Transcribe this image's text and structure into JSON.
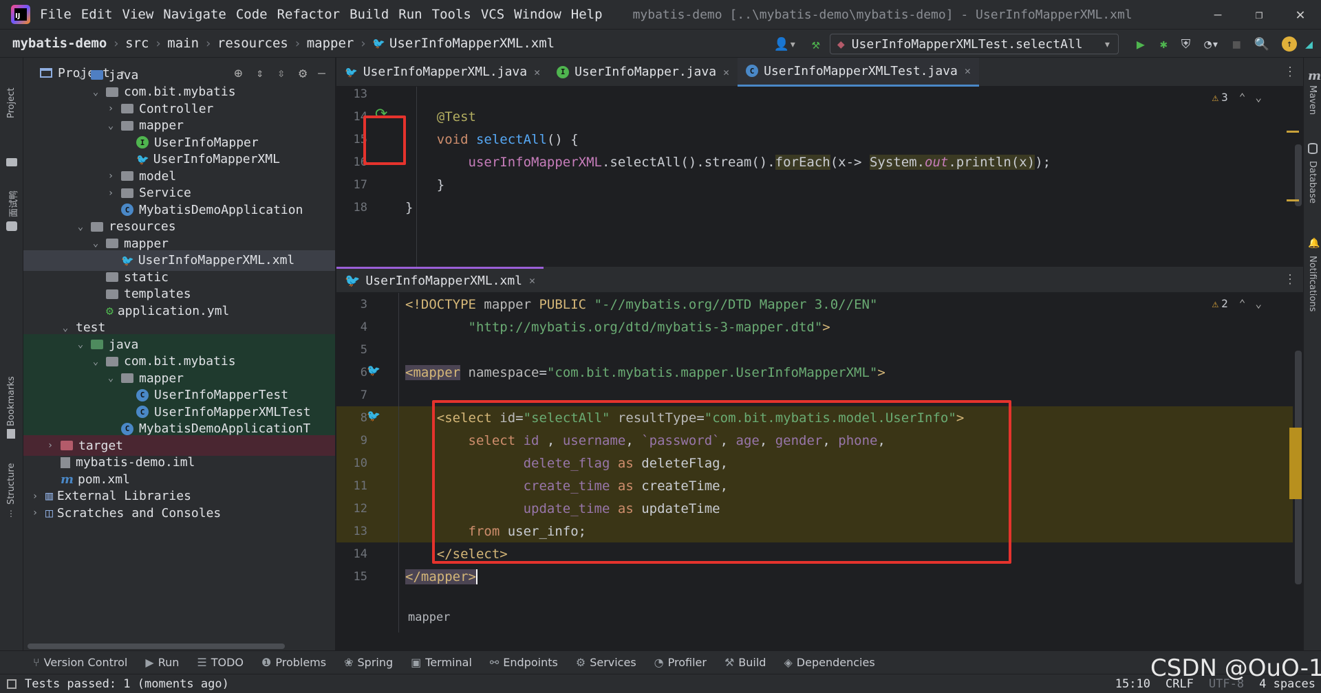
{
  "menu": [
    "File",
    "Edit",
    "View",
    "Navigate",
    "Code",
    "Refactor",
    "Build",
    "Run",
    "Tools",
    "VCS",
    "Window",
    "Help"
  ],
  "window_title": "mybatis-demo [..\\mybatis-demo\\mybatis-demo] - UserInfoMapperXML.xml",
  "breadcrumbs": [
    "mybatis-demo",
    "src",
    "main",
    "resources",
    "mapper",
    "UserInfoMapperXML.xml"
  ],
  "run_config": "UserInfoMapperXMLTest.selectAll",
  "left_stripe": {
    "project": "Project",
    "other": "面试鸭",
    "bookmarks": "Bookmarks",
    "structure": "Structure"
  },
  "right_stripe": {
    "maven": "Maven",
    "database": "Database",
    "notifications": "Notifications"
  },
  "project_panel": {
    "title": "Project",
    "tree": [
      {
        "label": "java",
        "depth": 3,
        "arrow": "open",
        "icon": "fold blue",
        "style": ""
      },
      {
        "label": "com.bit.mybatis",
        "depth": 4,
        "arrow": "open",
        "icon": "fold",
        "style": ""
      },
      {
        "label": "Controller",
        "depth": 5,
        "arrow": "closed",
        "icon": "fold",
        "style": ""
      },
      {
        "label": "mapper",
        "depth": 5,
        "arrow": "open",
        "icon": "fold",
        "style": ""
      },
      {
        "label": "UserInfoMapper",
        "depth": 6,
        "arrow": "",
        "icon": "interface",
        "style": ""
      },
      {
        "label": "UserInfoMapperXML",
        "depth": 6,
        "arrow": "",
        "icon": "bird",
        "style": ""
      },
      {
        "label": "model",
        "depth": 5,
        "arrow": "closed",
        "icon": "fold",
        "style": ""
      },
      {
        "label": "Service",
        "depth": 5,
        "arrow": "closed",
        "icon": "fold",
        "style": ""
      },
      {
        "label": "MybatisDemoApplication",
        "depth": 5,
        "arrow": "",
        "icon": "spring",
        "style": ""
      },
      {
        "label": "resources",
        "depth": 3,
        "arrow": "open",
        "icon": "fold",
        "style": ""
      },
      {
        "label": "mapper",
        "depth": 4,
        "arrow": "open",
        "icon": "fold",
        "style": ""
      },
      {
        "label": "UserInfoMapperXML.xml",
        "depth": 5,
        "arrow": "",
        "icon": "bird",
        "style": "sel"
      },
      {
        "label": "static",
        "depth": 4,
        "arrow": "",
        "icon": "fold",
        "style": ""
      },
      {
        "label": "templates",
        "depth": 4,
        "arrow": "",
        "icon": "fold",
        "style": ""
      },
      {
        "label": "application.yml",
        "depth": 4,
        "arrow": "",
        "icon": "yml",
        "style": ""
      },
      {
        "label": "test",
        "depth": 2,
        "arrow": "open",
        "icon": "",
        "style": ""
      },
      {
        "label": "java",
        "depth": 3,
        "arrow": "open",
        "icon": "fold green",
        "style": "green"
      },
      {
        "label": "com.bit.mybatis",
        "depth": 4,
        "arrow": "open",
        "icon": "fold",
        "style": "green"
      },
      {
        "label": "mapper",
        "depth": 5,
        "arrow": "open",
        "icon": "fold",
        "style": "green"
      },
      {
        "label": "UserInfoMapperTest",
        "depth": 6,
        "arrow": "",
        "icon": "class",
        "style": "green"
      },
      {
        "label": "UserInfoMapperXMLTest",
        "depth": 6,
        "arrow": "",
        "icon": "class",
        "style": "green"
      },
      {
        "label": "MybatisDemoApplicationT",
        "depth": 5,
        "arrow": "",
        "icon": "class",
        "style": "green"
      },
      {
        "label": "target",
        "depth": 1,
        "arrow": "closed",
        "icon": "fold red",
        "style": "red"
      },
      {
        "label": "mybatis-demo.iml",
        "depth": 1,
        "arrow": "",
        "icon": "file",
        "style": ""
      },
      {
        "label": "pom.xml",
        "depth": 1,
        "arrow": "",
        "icon": "maven",
        "style": ""
      },
      {
        "label": "External Libraries",
        "depth": 0,
        "arrow": "closed",
        "icon": "lib",
        "style": ""
      },
      {
        "label": "Scratches and Consoles",
        "depth": 0,
        "arrow": "closed",
        "icon": "scratch",
        "style": ""
      }
    ]
  },
  "top_tabs": [
    {
      "label": "UserInfoMapperXML.java",
      "active": false,
      "icon": "bird"
    },
    {
      "label": "UserInfoMapper.java",
      "active": false,
      "icon": "interface"
    },
    {
      "label": "UserInfoMapperXMLTest.java",
      "active": true,
      "icon": "class"
    }
  ],
  "top_editor": {
    "warnings": "3",
    "lines": [
      {
        "n": "13",
        "html": ""
      },
      {
        "n": "14",
        "html": "<span class='ann'>    @Test</span>"
      },
      {
        "n": "15",
        "html": "<span class='kw'>    void </span><span class='fn'>selectAll</span>() {"
      },
      {
        "n": "16",
        "html": "        <span class='field'>userInfoMapperXML</span>.selectAll().stream().<span style='background:#3b3a23'>forEach</span>(x-&gt; <span style='background:#3b3a23'>System.<span class='field it'>out</span>.println(x)</span>);"
      },
      {
        "n": "17",
        "html": "    }"
      },
      {
        "n": "18",
        "html": "}"
      }
    ]
  },
  "bottom_tab": "UserInfoMapperXML.xml",
  "bottom_editor": {
    "warnings": "2",
    "breadcrumb": "mapper",
    "lines": [
      {
        "n": "3",
        "hl": false,
        "html": "<span class='tag'>&lt;!DOCTYPE </span><span class='attr'>mapper</span> <span class='tag'>PUBLIC</span> <span class='val'>\"-//mybatis.org//DTD Mapper 3.0//EN\"</span>"
      },
      {
        "n": "4",
        "hl": false,
        "html": "        <span class='val'>\"http://mybatis.org/dtd/mybatis-3-mapper.dtd\"</span><span class='tag'>&gt;</span>"
      },
      {
        "n": "5",
        "hl": false,
        "html": ""
      },
      {
        "n": "6",
        "hl": false,
        "html": "<span class='tag tagbg'>&lt;mapper</span> <span class='attr'>namespace</span>=<span class='val'>\"com.bit.mybatis.mapper.UserInfoMapperXML\"</span><span class='tag'>&gt;</span>"
      },
      {
        "n": "7",
        "hl": false,
        "html": ""
      },
      {
        "n": "8",
        "hl": true,
        "html": "    <span class='tag'>&lt;select </span><span class='attr'>id</span>=<span class='val'>\"selectAll\"</span> <span class='attr'>resultType</span>=<span class='val'>\"com.bit.mybatis.model.UserInfo\"</span><span class='tag'>&gt;</span>"
      },
      {
        "n": "9",
        "hl": true,
        "html": "        <span class='sqlkw'>select </span><span class='sqlcol'>id</span> , <span class='sqlcol'>username</span>, <span class='sqlcol'>`password`</span>, <span class='sqlcol'>age</span>, <span class='sqlcol'>gender</span>, <span class='sqlcol'>phone</span>,"
      },
      {
        "n": "10",
        "hl": true,
        "html": "               <span class='sqlcol'>delete_flag</span> <span class='sqlkw'>as</span> deleteFlag,"
      },
      {
        "n": "11",
        "hl": true,
        "html": "               <span class='sqlcol'>create_time</span> <span class='sqlkw'>as</span> createTime,"
      },
      {
        "n": "12",
        "hl": true,
        "html": "               <span class='sqlcol'>update_time</span> <span class='sqlkw'>as</span> updateTime"
      },
      {
        "n": "13",
        "hl": true,
        "html": "        <span class='sqlkw'>from </span>user_info;"
      },
      {
        "n": "14",
        "hl": false,
        "html": "    <span class='tag'>&lt;/select&gt;</span>"
      },
      {
        "n": "15",
        "hl": false,
        "html": "<span class='tag tagbg'>&lt;/mapper&gt;</span><span style='border-left:2px solid #fff'></span>"
      }
    ]
  },
  "tool_windows": [
    {
      "icon": "⑂",
      "label": "Version Control"
    },
    {
      "icon": "▶",
      "label": "Run"
    },
    {
      "icon": "☰",
      "label": "TODO"
    },
    {
      "icon": "❶",
      "label": "Problems"
    },
    {
      "icon": "❀",
      "label": "Spring"
    },
    {
      "icon": "▣",
      "label": "Terminal"
    },
    {
      "icon": "⚯",
      "label": "Endpoints"
    },
    {
      "icon": "⚙",
      "label": "Services"
    },
    {
      "icon": "◔",
      "label": "Profiler"
    },
    {
      "icon": "⚒",
      "label": "Build"
    },
    {
      "icon": "◈",
      "label": "Dependencies"
    }
  ],
  "status": {
    "message": "Tests passed: 1 (moments ago)",
    "position": "15:10",
    "line_sep": "CRLF",
    "encoding": "UTF-8",
    "indent": "4 spaces"
  },
  "watermark": "CSDN @OuO-1",
  "colors": {
    "accent": "#4a88c7",
    "highlight_box": "#e5332d",
    "run_green": "#4fb54f"
  }
}
